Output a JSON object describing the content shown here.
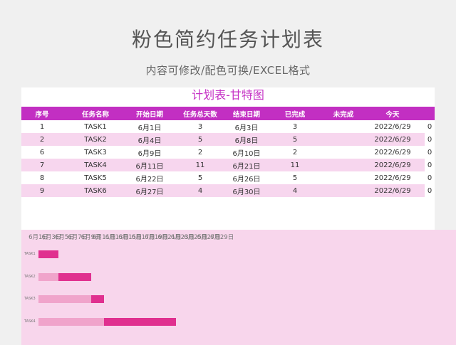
{
  "header": {
    "title": "粉色简约任务计划表",
    "subtitle": "内容可修改/配色可换/EXCEL格式"
  },
  "sheet": {
    "title": "计划表-甘特图",
    "columns": [
      "序号",
      "任务名称",
      "开始日期",
      "任务总天数",
      "结束日期",
      "已完成",
      "未完成",
      "今天",
      ""
    ],
    "rows": [
      {
        "no": "1",
        "name": "TASK1",
        "start": "6月1日",
        "days": "3",
        "end": "6月3日",
        "done": "3",
        "undone": "",
        "today": "2022/6/29",
        "extra": "0"
      },
      {
        "no": "2",
        "name": "TASK2",
        "start": "6月4日",
        "days": "5",
        "end": "6月8日",
        "done": "5",
        "undone": "",
        "today": "2022/6/29",
        "extra": "0"
      },
      {
        "no": "6",
        "name": "TASK3",
        "start": "6月9日",
        "days": "2",
        "end": "6月10日",
        "done": "2",
        "undone": "",
        "today": "2022/6/29",
        "extra": "0"
      },
      {
        "no": "7",
        "name": "TASK4",
        "start": "6月11日",
        "days": "11",
        "end": "6月21日",
        "done": "11",
        "undone": "",
        "today": "2022/6/29",
        "extra": "0"
      },
      {
        "no": "8",
        "name": "TASK5",
        "start": "6月22日",
        "days": "5",
        "end": "6月26日",
        "done": "5",
        "undone": "",
        "today": "2022/6/29",
        "extra": "0"
      },
      {
        "no": "9",
        "name": "TASK6",
        "start": "6月27日",
        "days": "4",
        "end": "6月30日",
        "done": "4",
        "undone": "",
        "today": "2022/6/29",
        "extra": "0"
      }
    ]
  },
  "chart_data": {
    "type": "bar",
    "x_ticks": [
      "6月1日",
      "6月3日",
      "6月5日",
      "6月7日",
      "6月9日",
      "6月11日",
      "6月13日",
      "6月15日",
      "6月17日",
      "6月19日",
      "6月21日",
      "6月23日",
      "6月25日",
      "6月27日",
      "6月29日"
    ],
    "x_tick_days": [
      1,
      3,
      5,
      7,
      9,
      11,
      13,
      15,
      17,
      19,
      21,
      23,
      25,
      27,
      29
    ],
    "tasks": [
      {
        "name": "TASK1",
        "start_day": 1,
        "days": 3
      },
      {
        "name": "TASK2",
        "start_day": 4,
        "days": 5
      },
      {
        "name": "TASK3",
        "start_day": 9,
        "days": 2
      },
      {
        "name": "TASK4",
        "start_day": 11,
        "days": 11
      }
    ],
    "colors": {
      "offset": "#f0a4cb",
      "duration": "#e0308f"
    }
  }
}
